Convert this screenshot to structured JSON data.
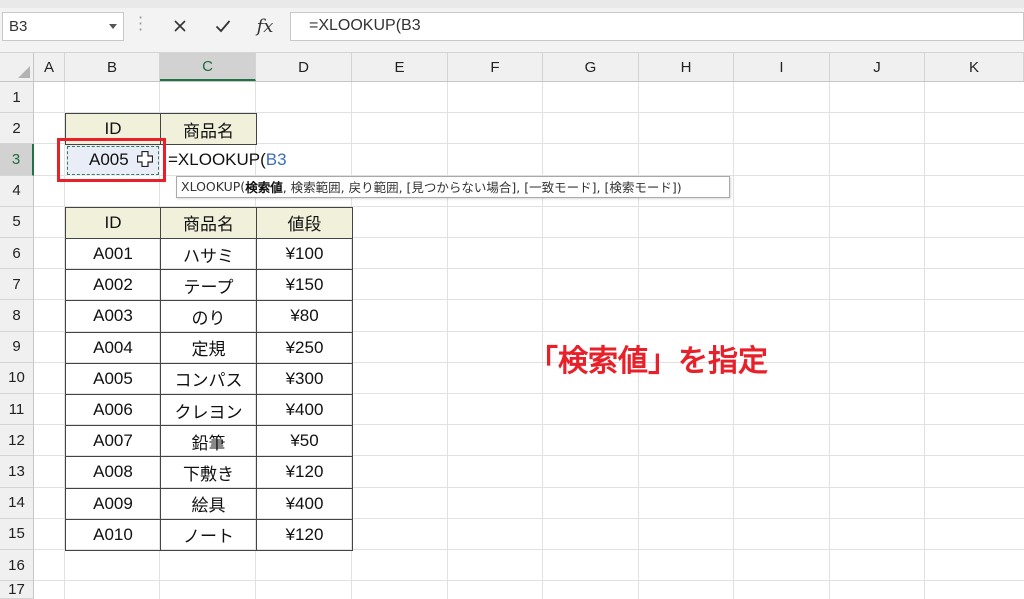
{
  "formula_bar": {
    "name_box": "B3",
    "cancel_icon": "close-icon",
    "enter_icon": "check-icon",
    "fx_label": "fx",
    "formula": "=XLOOKUP(B3"
  },
  "columns": [
    "A",
    "B",
    "C",
    "D",
    "E",
    "F",
    "G",
    "H",
    "I",
    "J",
    "K"
  ],
  "rows": [
    "1",
    "2",
    "3",
    "4",
    "5",
    "6",
    "7",
    "8",
    "9",
    "10",
    "11",
    "12",
    "13",
    "14",
    "15",
    "16",
    "17"
  ],
  "lookup": {
    "header_id": "ID",
    "header_name": "商品名",
    "b3_value": "A005",
    "editing_prefix": "=XLOOKUP(",
    "editing_ref": "B3"
  },
  "tooltip": {
    "func": "XLOOKUP(",
    "arg_active": "検索値",
    "rest": ", 検索範囲, 戻り範囲, [見つからない場合], [一致モード], [検索モード])"
  },
  "table": {
    "headers": [
      "ID",
      "商品名",
      "値段"
    ],
    "rows": [
      [
        "A001",
        "ハサミ",
        "¥100"
      ],
      [
        "A002",
        "テープ",
        "¥150"
      ],
      [
        "A003",
        "のり",
        "¥80"
      ],
      [
        "A004",
        "定規",
        "¥250"
      ],
      [
        "A005",
        "コンパス",
        "¥300"
      ],
      [
        "A006",
        "クレヨン",
        "¥400"
      ],
      [
        "A007",
        "鉛筆",
        "¥50"
      ],
      [
        "A008",
        "下敷き",
        "¥120"
      ],
      [
        "A009",
        "絵具",
        "¥400"
      ],
      [
        "A010",
        "ノート",
        "¥120"
      ]
    ]
  },
  "annotation": "「検索値」を指定",
  "colors": {
    "accent_red": "#e8202a",
    "excel_green": "#217346",
    "header_fill": "#f0f0db",
    "reference_blue": "#3a6fb8"
  }
}
